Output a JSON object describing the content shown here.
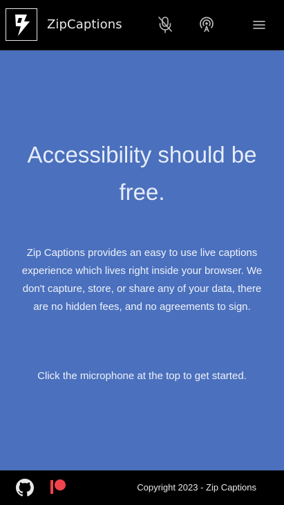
{
  "navbar": {
    "brand": "ZipCaptions",
    "icons": {
      "logo": "lightning-bolt-logo",
      "record": "microphone-icon",
      "broadcast": "broadcast-icon",
      "menu": "hamburger-menu-icon"
    }
  },
  "hero": {
    "title": "Accessibility should be free.",
    "description": "Zip Captions provides an easy to use live captions experience which lives right inside your browser. We don't capture, store, or share any of your data, there are no hidden fees, and no agreements to sign.",
    "cta": "Click the microphone at the top to get started."
  },
  "footer": {
    "copyright": "Copyright 2023 - Zip Captions",
    "icons": {
      "github": "github-icon",
      "patreon": "patreon-icon"
    }
  },
  "colors": {
    "background": "#4b70bd",
    "navbar": "#000000",
    "text": "#e6edf9",
    "patreon": "#f0434e"
  }
}
